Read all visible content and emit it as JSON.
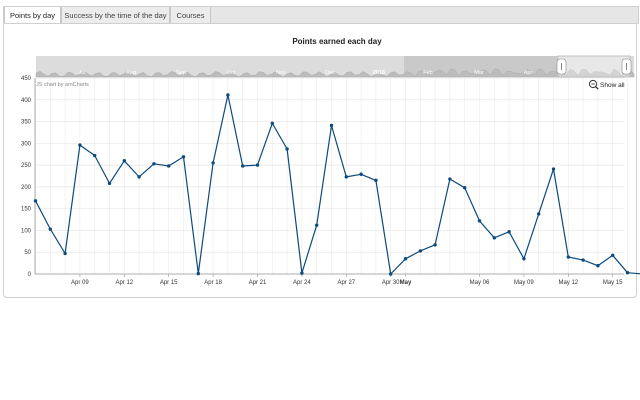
{
  "tabs": [
    {
      "label": "Points by day",
      "active": true
    },
    {
      "label": "Success by the time of the day",
      "active": false
    },
    {
      "label": "Courses",
      "active": false
    }
  ],
  "chart": {
    "credit": "JS chart by amCharts",
    "show_all_label": "Show all",
    "navigator_labels": [
      "Jul",
      "Aug",
      "Sep",
      "Oct",
      "Nov",
      "Dec",
      "2016",
      "Feb",
      "Mar",
      "Apr"
    ],
    "colors": {
      "line": "#0d4a7e",
      "grid": "#e6e6e6",
      "navigator": "#d2d2d2",
      "navigator_fill": "#bcbcbc"
    }
  },
  "chart_data": {
    "type": "line",
    "title": "Points earned each day",
    "xlabel": "",
    "ylabel": "",
    "ylim": [
      0,
      450
    ],
    "y_ticks": [
      0,
      50,
      100,
      150,
      200,
      250,
      300,
      350,
      400,
      450
    ],
    "x_ticks": [
      "Apr 09",
      "Apr 12",
      "Apr 15",
      "Apr 18",
      "Apr 21",
      "Apr 24",
      "Apr 27",
      "Apr 30",
      "May",
      "May 06",
      "May 09",
      "May 12",
      "May 15"
    ],
    "grid": true,
    "legend": "none",
    "x": [
      "Apr 06",
      "Apr 07",
      "Apr 08",
      "Apr 09",
      "Apr 10",
      "Apr 11",
      "Apr 12",
      "Apr 13",
      "Apr 14",
      "Apr 15",
      "Apr 16",
      "Apr 17",
      "Apr 18",
      "Apr 19",
      "Apr 20",
      "Apr 21",
      "Apr 22",
      "Apr 23",
      "Apr 24",
      "Apr 25",
      "Apr 26",
      "Apr 27",
      "Apr 28",
      "Apr 29",
      "Apr 30",
      "May 01",
      "May 02",
      "May 03",
      "May 04",
      "May 05",
      "May 06",
      "May 07",
      "May 08",
      "May 09",
      "May 10",
      "May 11",
      "May 12",
      "May 13",
      "May 14",
      "May 15",
      "May 16",
      "May 17"
    ],
    "values": [
      168,
      103,
      47,
      296,
      272,
      208,
      260,
      223,
      253,
      248,
      269,
      1,
      255,
      411,
      248,
      250,
      346,
      287,
      2,
      112,
      341,
      223,
      229,
      215,
      0,
      35,
      53,
      67,
      218,
      198,
      122,
      83,
      97,
      35,
      138,
      241,
      39,
      32,
      19,
      43,
      3,
      0
    ]
  }
}
